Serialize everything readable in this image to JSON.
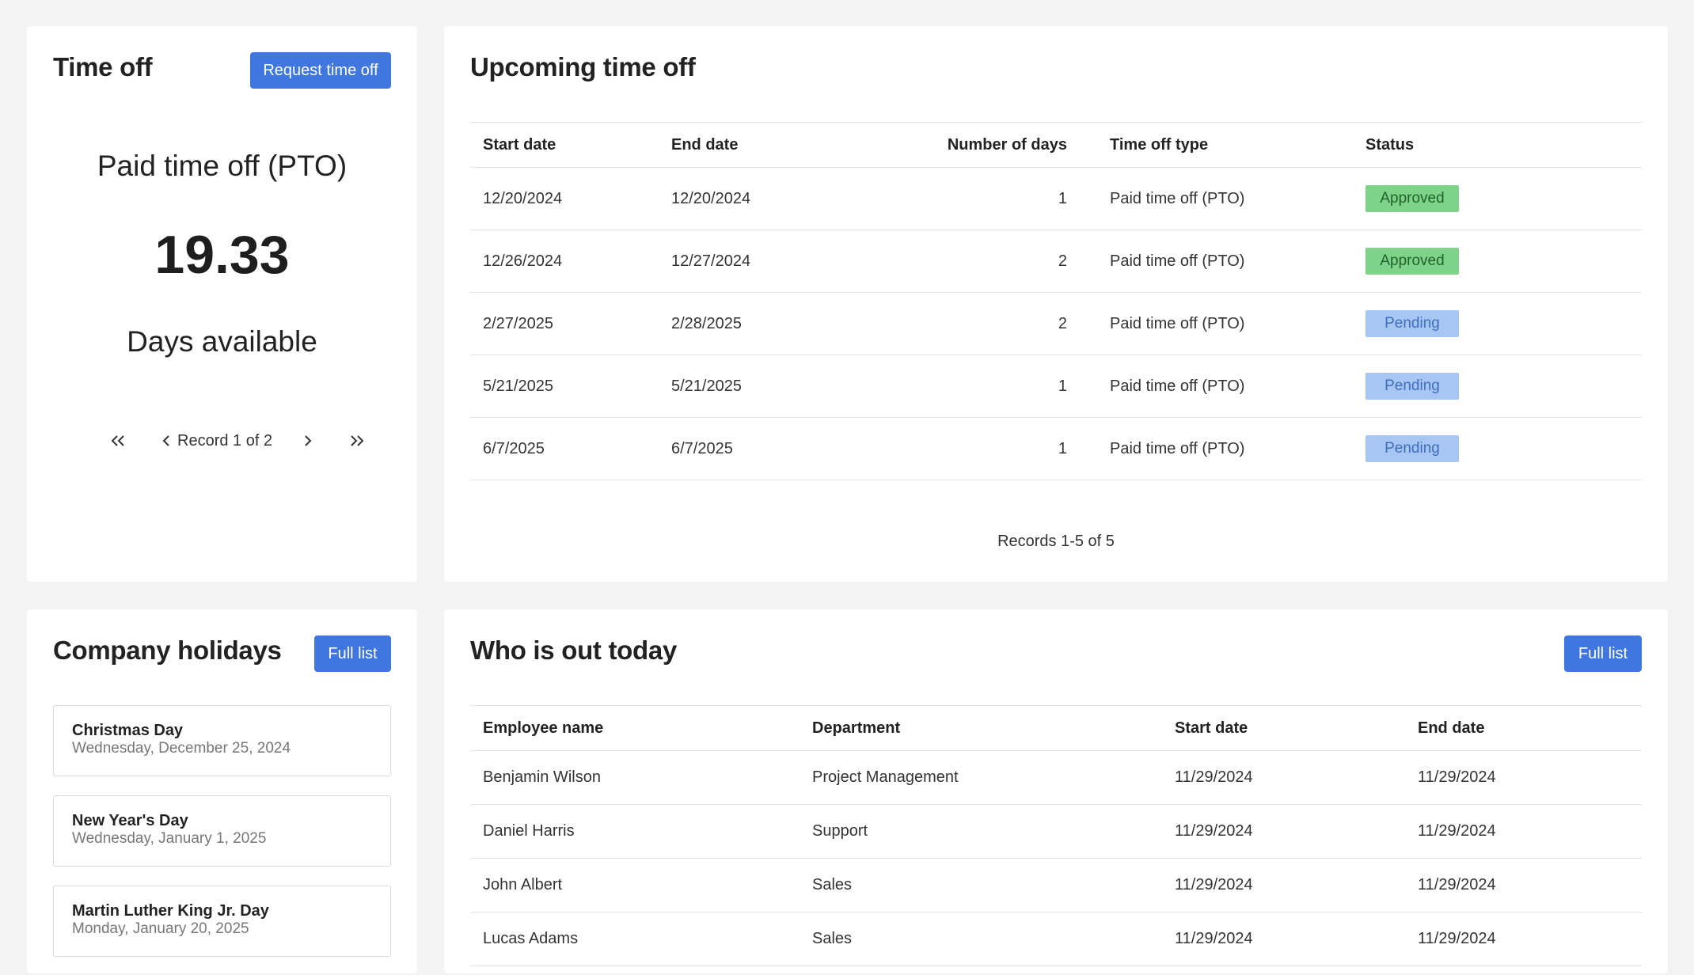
{
  "time_off": {
    "title": "Time off",
    "request_button": "Request time off",
    "type_label": "Paid time off (PTO)",
    "days_value": "19.33",
    "days_label": "Days available",
    "pager_text": "Record 1 of 2"
  },
  "upcoming": {
    "title": "Upcoming time off",
    "columns": [
      "Start date",
      "End date",
      "Number of days",
      "Time off type",
      "Status"
    ],
    "rows": [
      {
        "start": "12/20/2024",
        "end": "12/20/2024",
        "days": "1",
        "type": "Paid time off (PTO)",
        "status": "Approved"
      },
      {
        "start": "12/26/2024",
        "end": "12/27/2024",
        "days": "2",
        "type": "Paid time off (PTO)",
        "status": "Approved"
      },
      {
        "start": "2/27/2025",
        "end": "2/28/2025",
        "days": "2",
        "type": "Paid time off (PTO)",
        "status": "Pending"
      },
      {
        "start": "5/21/2025",
        "end": "5/21/2025",
        "days": "1",
        "type": "Paid time off (PTO)",
        "status": "Pending"
      },
      {
        "start": "6/7/2025",
        "end": "6/7/2025",
        "days": "1",
        "type": "Paid time off (PTO)",
        "status": "Pending"
      }
    ],
    "records_text": "Records 1-5 of 5"
  },
  "holidays": {
    "title": "Company holidays",
    "full_list_button": "Full list",
    "items": [
      {
        "name": "Christmas Day",
        "date": "Wednesday, December 25, 2024"
      },
      {
        "name": "New Year's Day",
        "date": "Wednesday, January 1, 2025"
      },
      {
        "name": "Martin Luther King Jr. Day",
        "date": "Monday, January 20, 2025"
      }
    ]
  },
  "who_is_out": {
    "title": "Who is out today",
    "full_list_button": "Full list",
    "columns": [
      "Employee name",
      "Department",
      "Start date",
      "End date"
    ],
    "rows": [
      {
        "name": "Benjamin Wilson",
        "department": "Project Management",
        "start": "11/29/2024",
        "end": "11/29/2024"
      },
      {
        "name": "Daniel Harris",
        "department": "Support",
        "start": "11/29/2024",
        "end": "11/29/2024"
      },
      {
        "name": "John Albert",
        "department": "Sales",
        "start": "11/29/2024",
        "end": "11/29/2024"
      },
      {
        "name": "Lucas Adams",
        "department": "Sales",
        "start": "11/29/2024",
        "end": "11/29/2024"
      }
    ]
  },
  "colors": {
    "accent": "#3f76e0",
    "approved_bg": "#7dd488",
    "pending_bg": "#a7c6f3",
    "page_bg": "#f3f3f3"
  },
  "icons": [
    "first-page-icon",
    "prev-page-icon",
    "next-page-icon",
    "last-page-icon"
  ]
}
